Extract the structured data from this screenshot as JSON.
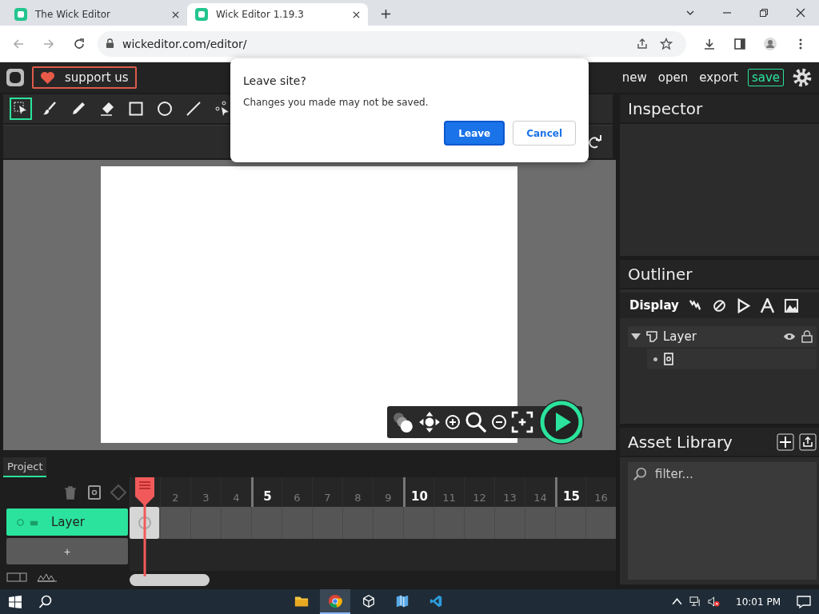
{
  "browser": {
    "tabs": [
      {
        "title": "The Wick Editor",
        "selected": false
      },
      {
        "title": "Wick Editor 1.19.3",
        "selected": true
      }
    ],
    "url": "wickeditor.com/editor/"
  },
  "topbar": {
    "support": "support us",
    "menu": [
      "new",
      "open",
      "export"
    ],
    "save": "save"
  },
  "tools": [
    {
      "kind": "select",
      "selected": true
    },
    {
      "kind": "brush",
      "selected": false
    },
    {
      "kind": "pencil",
      "selected": false
    },
    {
      "kind": "eraser",
      "selected": false
    },
    {
      "kind": "rectangle",
      "selected": false
    },
    {
      "kind": "ellipse",
      "selected": false
    },
    {
      "kind": "line",
      "selected": false
    },
    {
      "kind": "path",
      "selected": false
    }
  ],
  "inspector": {
    "title": "Inspector"
  },
  "outliner": {
    "title": "Outliner",
    "display": "Display",
    "layer": {
      "name": "Layer",
      "expanded": true
    }
  },
  "assets": {
    "title": "Asset Library",
    "placeholder": "filter..."
  },
  "timeline": {
    "tab": "Project",
    "layers": [
      {
        "name": "Layer",
        "selected": true
      }
    ],
    "add": "+",
    "frames": [
      {
        "label": "2",
        "major": false
      },
      {
        "label": "3",
        "major": false
      },
      {
        "label": "4",
        "major": false
      },
      {
        "label": "5",
        "major": true
      },
      {
        "label": "6",
        "major": false
      },
      {
        "label": "7",
        "major": false
      },
      {
        "label": "8",
        "major": false
      },
      {
        "label": "9",
        "major": false
      },
      {
        "label": "10",
        "major": true
      },
      {
        "label": "11",
        "major": false
      },
      {
        "label": "12",
        "major": false
      },
      {
        "label": "13",
        "major": false
      },
      {
        "label": "14",
        "major": false
      },
      {
        "label": "15",
        "major": true
      },
      {
        "label": "16",
        "major": false
      }
    ]
  },
  "dialog": {
    "title": "Leave site?",
    "message": "Changes you made may not be saved.",
    "buttons": [
      {
        "label": "Leave",
        "primary": true
      },
      {
        "label": "Cancel",
        "primary": false
      }
    ]
  },
  "taskbar": {
    "time": "10:01 PM",
    "apps": [
      {
        "kind": "folder",
        "active": false
      },
      {
        "kind": "browser",
        "active": true
      },
      {
        "kind": "cube",
        "active": false
      },
      {
        "kind": "map",
        "active": false
      },
      {
        "kind": "code",
        "active": false
      }
    ]
  }
}
